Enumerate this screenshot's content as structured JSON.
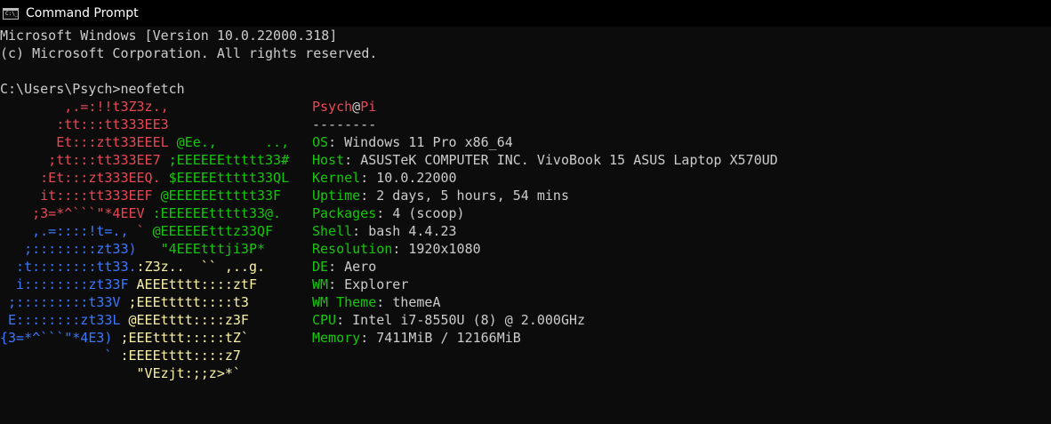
{
  "window": {
    "title": "Command Prompt",
    "icon": "cmd-icon",
    "icon_text": "C:\\_"
  },
  "header_lines": [
    "Microsoft Windows [Version 10.0.22000.318]",
    "(c) Microsoft Corporation. All rights reserved.",
    "",
    "C:\\Users\\Psych>neofetch"
  ],
  "colors": {
    "red": "#e74856",
    "green": "#16c60c",
    "blue": "#3b78ff",
    "yellow": "#f9f1a5",
    "text": "#cccccc"
  },
  "art": [
    [
      [
        "        ,.=:!!t3Z3z.,",
        "red"
      ]
    ],
    [
      [
        "       :tt:::tt333EE3",
        "red"
      ]
    ],
    [
      [
        "       Et:::ztt33EEEL",
        "red"
      ],
      [
        " @Ee.,      ..,",
        "green"
      ]
    ],
    [
      [
        "      ;tt:::tt333EE7",
        "red"
      ],
      [
        " ;EEEEEEttttt33#",
        "green"
      ]
    ],
    [
      [
        "     :Et:::zt333EEQ.",
        "red"
      ],
      [
        " $EEEEEttttt33QL",
        "green"
      ]
    ],
    [
      [
        "     it::::tt333EEF",
        "red"
      ],
      [
        " @EEEEEEttttt33F",
        "green"
      ]
    ],
    [
      [
        "    ;3=*^```\"*4EEV",
        "red"
      ],
      [
        " :EEEEEEttttt33@.",
        "green"
      ]
    ],
    [
      [
        "    ,.=::::!t=., ",
        "blue"
      ],
      [
        "`",
        "red"
      ],
      [
        " @EEEEEEtttz33QF",
        "green"
      ]
    ],
    [
      [
        "   ;::::::::zt33)",
        "blue"
      ],
      [
        "   \"4EEEtttji3P*",
        "green"
      ]
    ],
    [
      [
        "  :t::::::::tt33.",
        "blue"
      ],
      [
        ":Z3z..  `` ,..g.",
        "yellow"
      ]
    ],
    [
      [
        "  i::::::::zt33F",
        "blue"
      ],
      [
        " AEEEtttt::::ztF",
        "yellow"
      ]
    ],
    [
      [
        " ;:::::::::t33V",
        "blue"
      ],
      [
        " ;EEEttttt::::t3",
        "yellow"
      ]
    ],
    [
      [
        " E::::::::zt33L",
        "blue"
      ],
      [
        " @EEEtttt::::z3F",
        "yellow"
      ]
    ],
    [
      [
        "{3=*^```\"*4E3)",
        "blue"
      ],
      [
        " ;EEEtttt:::::tZ`",
        "yellow"
      ]
    ],
    [
      [
        "             `",
        "blue"
      ],
      [
        " :EEEEtttt::::z7",
        "yellow"
      ]
    ],
    [
      [
        "                 \"VEzjt:;;z>*`",
        "yellow"
      ]
    ]
  ],
  "info": {
    "user": "Psych",
    "at": "@",
    "host": "Pi",
    "separator": "--------",
    "fields": [
      {
        "label": "OS",
        "value": "Windows 11 Pro x86_64"
      },
      {
        "label": "Host",
        "value": "ASUSTeK COMPUTER INC. VivoBook 15 ASUS Laptop X570UD"
      },
      {
        "label": "Kernel",
        "value": "10.0.22000"
      },
      {
        "label": "Uptime",
        "value": "2 days, 5 hours, 54 mins"
      },
      {
        "label": "Packages",
        "value": "4 (scoop)"
      },
      {
        "label": "Shell",
        "value": "bash 4.4.23"
      },
      {
        "label": "Resolution",
        "value": "1920x1080"
      },
      {
        "label": "DE",
        "value": "Aero"
      },
      {
        "label": "WM",
        "value": "Explorer"
      },
      {
        "label": "WM Theme",
        "value": "themeA"
      },
      {
        "label": "CPU",
        "value": "Intel i7-8550U (8) @ 2.000GHz"
      },
      {
        "label": "Memory",
        "value": "7411MiB / 12166MiB"
      }
    ]
  }
}
